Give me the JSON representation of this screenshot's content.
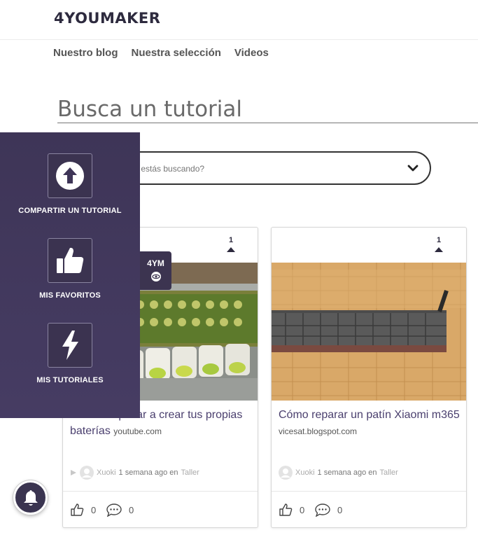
{
  "brand": {
    "logo": "4YOUMAKER"
  },
  "nav": {
    "items": [
      {
        "label": "Nuestro blog"
      },
      {
        "label": "Nuestra selección"
      },
      {
        "label": "Videos"
      }
    ]
  },
  "search": {
    "title": "Busca un tutorial",
    "placeholder": "¿Qué estás buscando?"
  },
  "sidebar": {
    "items": [
      {
        "label": "COMPARTIR UN TUTORIAL",
        "icon": "arrow-up-circle-icon"
      },
      {
        "label": "MIS FAVORITOS",
        "icon": "thumbs-up-icon"
      },
      {
        "label": "MIS TUTORIALES",
        "icon": "lightning-icon"
      }
    ],
    "badge": "4YM"
  },
  "cards": [
    {
      "votes": "1",
      "title": "Cómo empezar a crear tus propias baterías",
      "source": "youtube.com",
      "author": "Xuoki",
      "time": "1 semana ago en",
      "category": "Taller",
      "likes": "0",
      "comments": "0"
    },
    {
      "votes": "1",
      "title": "Cómo reparar un patín Xiaomi m365",
      "source": "vicesat.blogspot.com",
      "author": "Xuoki",
      "time": "1 semana ago en",
      "category": "Taller",
      "likes": "0",
      "comments": "0"
    }
  ],
  "colors": {
    "sidebar_bg": "#3e3557",
    "accent": "#4a3f6e",
    "text": "#333333"
  }
}
